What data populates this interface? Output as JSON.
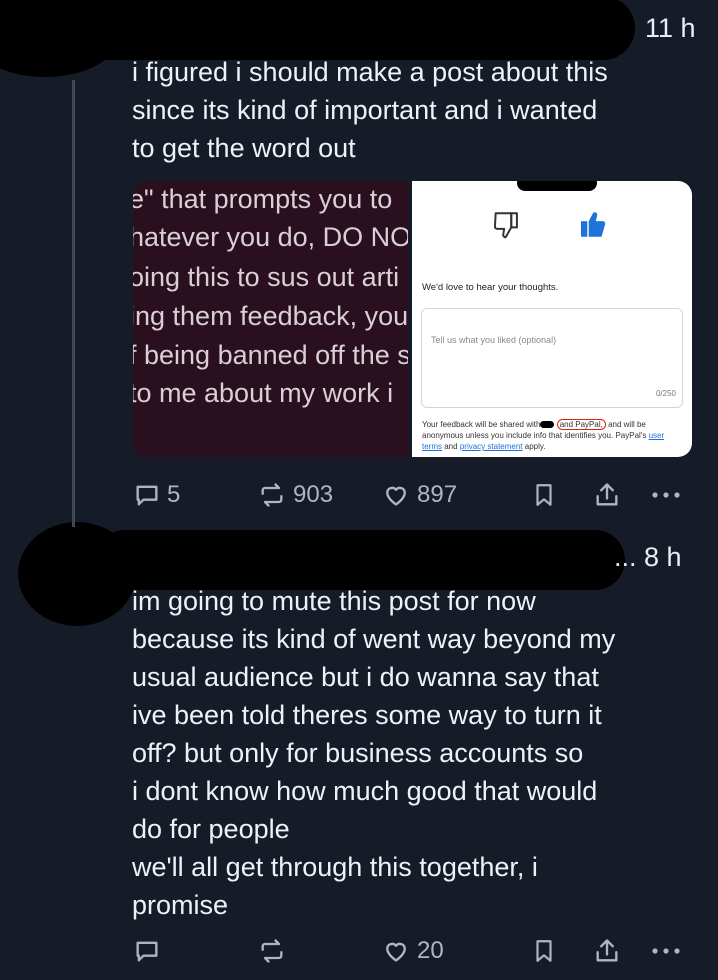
{
  "posts": [
    {
      "time": "11 h",
      "text_lines": [
        "i figured i should make a post about this",
        "since its kind of important and i wanted",
        "to get the word out"
      ],
      "media": {
        "left_text_lines": [
          "e\" that prompts you to",
          "hatever you do, DO NO",
          "oing this to sus out arti",
          "ing them feedback, you",
          "f being banned off the s",
          "to me about my work i"
        ],
        "feedback_prompt": "We'd love to hear your thoughts.",
        "input_placeholder": "Tell us what you liked (optional)",
        "char_count": "0/250",
        "disclaimer_before": "Your feedback will be shared with",
        "disclaimer_circled": "and PayPal,",
        "disclaimer_after": "and will be anonymous unless you include info that identifies you. PayPal's",
        "link_user_terms": "user terms",
        "disclaimer_and": "and",
        "link_privacy": "privacy statement",
        "disclaimer_end": "apply."
      },
      "actions": {
        "replies": "5",
        "reposts": "903",
        "likes": "897"
      }
    },
    {
      "time": "... 8 h",
      "text_lines": [
        "im going to mute this post for now",
        "because its kind of went way beyond my",
        "usual audience but i do wanna say that",
        "ive been told theres some way to turn it",
        "off? but only for business accounts so",
        "i dont know how much good that would",
        "do for people",
        "we'll all get through this together, i",
        "promise"
      ],
      "actions": {
        "replies": "",
        "reposts": "",
        "likes": "20"
      }
    }
  ],
  "colors": {
    "background": "#151c28",
    "text": "#eef2f6",
    "action_icon": "#aeb6c1",
    "thumbs_up": "#1e73d8",
    "redaction": "#000000"
  },
  "icons": [
    "reply-icon",
    "repost-icon",
    "heart-icon",
    "bookmark-icon",
    "share-icon",
    "more-icon",
    "thumbs-down-icon",
    "thumbs-up-icon"
  ]
}
